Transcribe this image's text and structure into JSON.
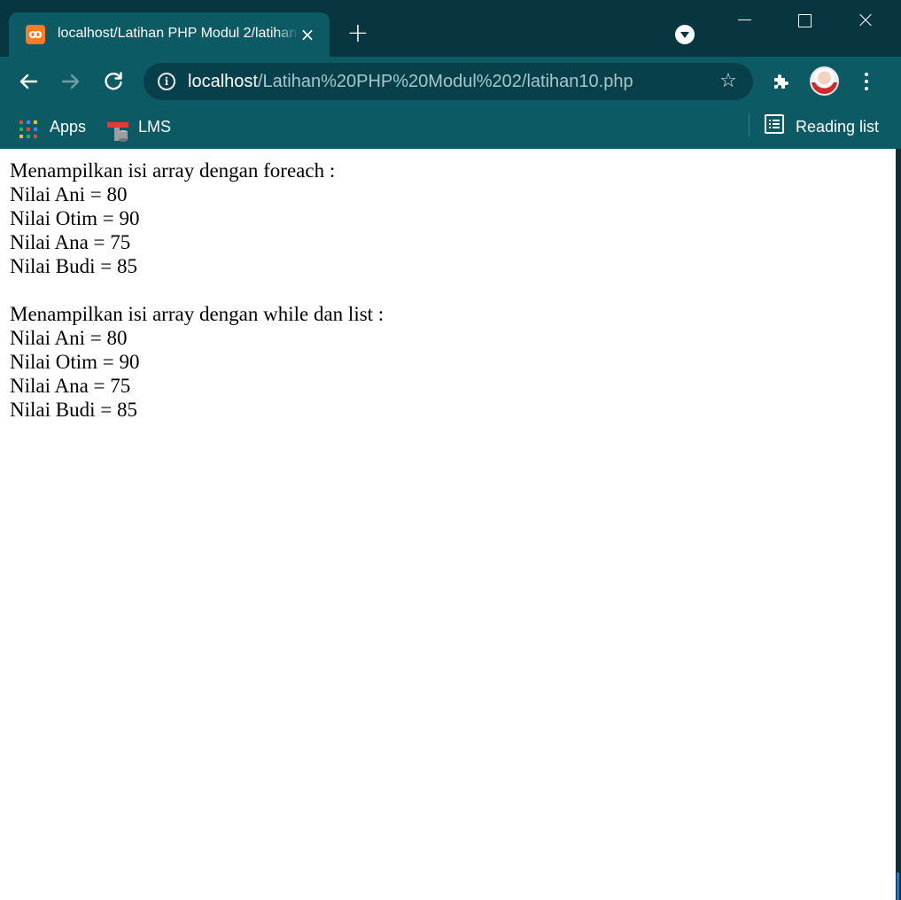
{
  "window": {
    "tab_title": "localhost/Latihan PHP Modul 2/latihan10.php",
    "tab_favicon": "xampp-icon",
    "close_tab": "×",
    "new_tab": "+"
  },
  "toolbar": {
    "url_host": "localhost",
    "url_path": "/Latihan%20PHP%20Modul%202/latihan10.php",
    "info_icon": "i",
    "star_icon": "☆"
  },
  "bookmarks": {
    "items": [
      {
        "label": "Apps",
        "icon": "apps-grid-icon"
      },
      {
        "label": "LMS",
        "icon": "lms-icon"
      }
    ],
    "reading_list": "Reading list"
  },
  "page": {
    "foreach_heading": "Menampilkan isi array dengan foreach :",
    "foreach_lines": [
      "Nilai Ani = 80",
      "Nilai Otim = 90",
      "Nilai Ana = 75",
      "Nilai Budi = 85"
    ],
    "while_heading": "Menampilkan isi array dengan while dan list :",
    "while_lines": [
      "Nilai Ani = 80",
      "Nilai Otim = 90",
      "Nilai Ana = 75",
      "Nilai Budi = 85"
    ]
  },
  "colors": {
    "frame": "#073540",
    "toolbar": "#0c5a63",
    "omnibox": "#073f4a",
    "page_background": "#ffffff",
    "text": "#000000"
  }
}
